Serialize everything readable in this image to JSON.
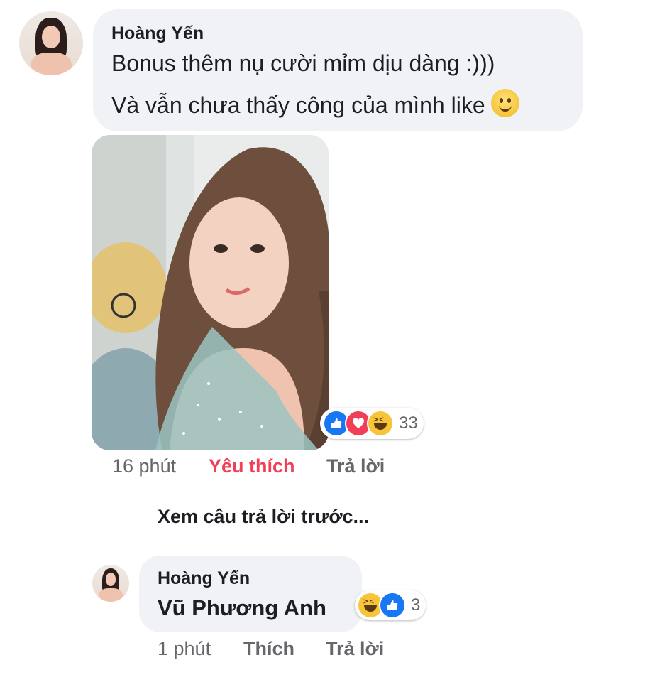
{
  "comment1": {
    "author": "Hoàng Yến",
    "lines": [
      "Bonus thêm nụ cười mỉm dịu dàng :)))",
      "Và vẫn chưa thấy công của mình like"
    ],
    "emoji": "slightly-smiling-face-icon",
    "reactions": {
      "icons": [
        "like",
        "love",
        "haha"
      ],
      "count": "33"
    },
    "time": "16 phút",
    "like_label": "Yêu thích",
    "reply_label": "Trả lời"
  },
  "view_previous": "Xem câu trả lời trước...",
  "comment2": {
    "author": "Hoàng Yến",
    "text": "Vũ Phương Anh",
    "reactions": {
      "icons": [
        "haha",
        "like"
      ],
      "count": "3"
    },
    "time": "1 phút",
    "like_label": "Thích",
    "reply_label": "Trả lời"
  },
  "colors": {
    "bubble": "#f0f2f5",
    "liked": "#f33e58",
    "meta": "#65676b",
    "like": "#1877f2"
  }
}
